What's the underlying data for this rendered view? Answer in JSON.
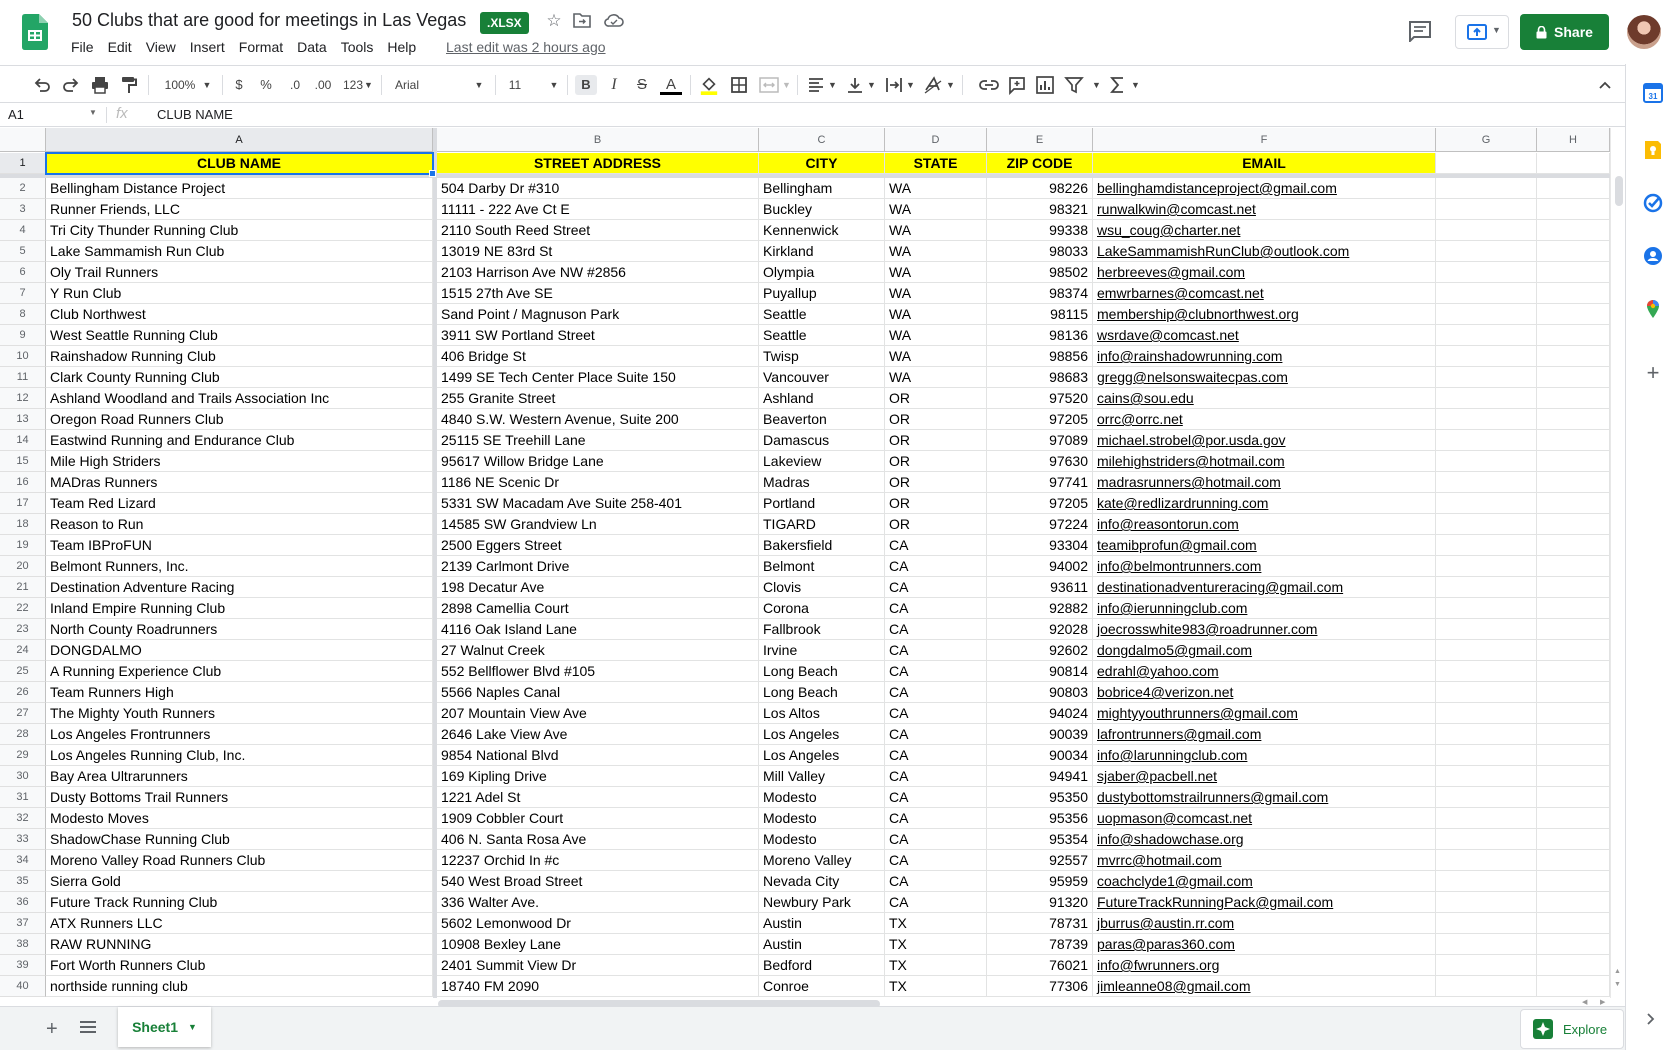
{
  "header": {
    "title": "50 Clubs that are good for meetings in Las Vegas",
    "file_badge": ".XLSX",
    "menu": [
      "File",
      "Edit",
      "View",
      "Insert",
      "Format",
      "Data",
      "Tools",
      "Help"
    ],
    "last_edit": "Last edit was 2 hours ago",
    "share_label": "Share"
  },
  "toolbar": {
    "zoom": "100%",
    "currency": "$",
    "percent": "%",
    "decrease_decimal": ".0",
    "increase_decimal": ".00",
    "more_formats": "123",
    "font": "Arial",
    "font_size": "11",
    "bold": "B",
    "italic": "I",
    "strike": "S",
    "text_color": "A"
  },
  "formula_bar": {
    "cell_ref": "A1",
    "fx": "fx",
    "value": "CLUB NAME"
  },
  "columns": [
    "A",
    "B",
    "C",
    "D",
    "E",
    "F",
    "G",
    "H"
  ],
  "headers": [
    "CLUB NAME",
    "STREET ADDRESS",
    "CITY",
    "STATE",
    "ZIP CODE",
    "EMAIL"
  ],
  "rows": [
    [
      "Bellingham Distance Project",
      "504 Darby Dr #310",
      "Bellingham",
      "WA",
      "98226",
      "bellinghamdistanceproject@gmail.com"
    ],
    [
      "Runner Friends, LLC",
      "11111 - 222 Ave Ct E",
      "Buckley",
      "WA",
      "98321",
      "runwalkwin@comcast.net"
    ],
    [
      "Tri City Thunder Running Club",
      "2110 South Reed Street",
      "Kennenwick",
      "WA",
      "99338",
      "wsu_coug@charter.net"
    ],
    [
      "Lake Sammamish Run Club",
      "13019 NE 83rd St",
      "Kirkland",
      "WA",
      "98033",
      "LakeSammamishRunClub@outlook.com"
    ],
    [
      "Oly Trail Runners",
      "2103 Harrison Ave NW #2856",
      "Olympia",
      "WA",
      "98502",
      "herbreeves@gmail.com"
    ],
    [
      "Y Run Club",
      "1515 27th Ave SE",
      "Puyallup",
      "WA",
      "98374",
      "emwrbarnes@comcast.net"
    ],
    [
      "Club Northwest",
      "Sand Point / Magnuson Park",
      "Seattle",
      "WA",
      "98115",
      "membership@clubnorthwest.org"
    ],
    [
      "West Seattle Running Club",
      "3911 SW Portland Street",
      "Seattle",
      "WA",
      "98136",
      "wsrdave@comcast.net"
    ],
    [
      "Rainshadow Running Club",
      "406 Bridge St",
      "Twisp",
      "WA",
      "98856",
      "info@rainshadowrunning.com"
    ],
    [
      "Clark County Running Club",
      "1499 SE Tech Center Place Suite 150",
      "Vancouver",
      "WA",
      "98683",
      "gregg@nelsonswaitecpas.com"
    ],
    [
      "Ashland Woodland and Trails Association Inc",
      "255 Granite Street",
      "Ashland",
      "OR",
      "97520",
      "cains@sou.edu"
    ],
    [
      "Oregon Road Runners Club",
      "4840 S.W. Western Avenue, Suite 200",
      "Beaverton",
      "OR",
      "97205",
      "orrc@orrc.net"
    ],
    [
      "Eastwind Running and Endurance Club",
      "25115 SE Treehill Lane",
      "Damascus",
      "OR",
      "97089",
      "michael.strobel@por.usda.gov"
    ],
    [
      "Mile High Striders",
      "95617 Willow Bridge Lane",
      "Lakeview",
      "OR",
      "97630",
      "milehighstriders@hotmail.com"
    ],
    [
      "MADras Runners",
      "1186 NE Scenic Dr",
      "Madras",
      "OR",
      "97741",
      "madrasrunners@hotmail.com"
    ],
    [
      "Team Red Lizard",
      "5331 SW Macadam Ave Suite 258-401",
      "Portland",
      "OR",
      "97205",
      "kate@redlizardrunning.com"
    ],
    [
      "Reason to Run",
      "14585 SW Grandview Ln",
      "TIGARD",
      "OR",
      "97224",
      "info@reasontorun.com"
    ],
    [
      "Team IBProFUN",
      "2500 Eggers Street",
      "Bakersfield",
      "CA",
      "93304",
      "teamibprofun@gmail.com"
    ],
    [
      "Belmont Runners, Inc.",
      "2139 Carlmont Drive",
      "Belmont",
      "CA",
      "94002",
      "info@belmontrunners.com"
    ],
    [
      "Destination Adventure Racing",
      "198 Decatur Ave",
      "Clovis",
      "CA",
      "93611",
      "destinationadventureracing@gmail.com"
    ],
    [
      "Inland Empire Running Club",
      "2898 Camellia Court",
      "Corona",
      "CA",
      "92882",
      "info@ierunningclub.com"
    ],
    [
      "North County Roadrunners",
      "4116 Oak Island Lane",
      "Fallbrook",
      "CA",
      "92028",
      "joecrosswhite983@roadrunner.com"
    ],
    [
      "DONGDALMO",
      "27 Walnut Creek",
      "Irvine",
      "CA",
      "92602",
      "dongdalmo5@gmail.com"
    ],
    [
      "A Running Experience Club",
      "552 Bellflower Blvd #105",
      "Long Beach",
      "CA",
      "90814",
      "edrahl@yahoo.com"
    ],
    [
      "Team Runners High",
      "5566 Naples Canal",
      "Long Beach",
      "CA",
      "90803",
      "bobrice4@verizon.net"
    ],
    [
      "The Mighty Youth Runners",
      "207 Mountain View Ave",
      "Los Altos",
      "CA",
      "94024",
      "mightyyouthrunners@gmail.com"
    ],
    [
      "Los Angeles Frontrunners",
      "2646 Lake View Ave",
      "Los Angeles",
      "CA",
      "90039",
      "lafrontrunners@gmail.com"
    ],
    [
      "Los Angeles Running Club, Inc.",
      "9854 National Blvd",
      "Los Angeles",
      "CA",
      "90034",
      "info@larunningclub.com"
    ],
    [
      "Bay Area Ultrarunners",
      "169 Kipling Drive",
      "Mill Valley",
      "CA",
      "94941",
      "sjaber@pacbell.net"
    ],
    [
      "Dusty Bottoms Trail Runners",
      "1221 Adel St",
      "Modesto",
      "CA",
      "95350",
      "dustybottomstrailrunners@gmail.com"
    ],
    [
      "Modesto Moves",
      "1909 Cobbler Court",
      "Modesto",
      "CA",
      "95356",
      "uopmason@comcast.net"
    ],
    [
      "ShadowChase Running Club",
      "406 N. Santa Rosa Ave",
      "Modesto",
      "CA",
      "95354",
      "info@shadowchase.org"
    ],
    [
      "Moreno Valley Road Runners Club",
      "12237 Orchid In #c",
      "Moreno Valley",
      "CA",
      "92557",
      "mvrrc@hotmail.com"
    ],
    [
      "Sierra Gold",
      "540 West Broad Street",
      "Nevada City",
      "CA",
      "95959",
      "coachclyde1@gmail.com"
    ],
    [
      "Future Track Running Club",
      "336 Walter Ave.",
      "Newbury Park",
      "CA",
      "91320",
      "FutureTrackRunningPack@gmail.com"
    ],
    [
      "ATX Runners LLC",
      "5602 Lemonwood Dr",
      "Austin",
      "TX",
      "78731",
      "jburrus@austin.rr.com"
    ],
    [
      "RAW RUNNING",
      "10908 Bexley Lane",
      "Austin",
      "TX",
      "78739",
      "paras@paras360.com"
    ],
    [
      "Fort Worth Runners Club",
      "2401 Summit View Dr",
      "Bedford",
      "TX",
      "76021",
      "info@fwrunners.org"
    ],
    [
      "northside running club",
      "18740 FM 2090",
      "Conroe",
      "TX",
      "77306",
      "jimleanne08@gmail.com"
    ]
  ],
  "first_row_number": 1,
  "bottom": {
    "sheet_tab": "Sheet1",
    "explore_label": "Explore"
  },
  "colors": {
    "header_fill": "#ffff00",
    "accent_green": "#188038",
    "selection_blue": "#1a73e8"
  }
}
